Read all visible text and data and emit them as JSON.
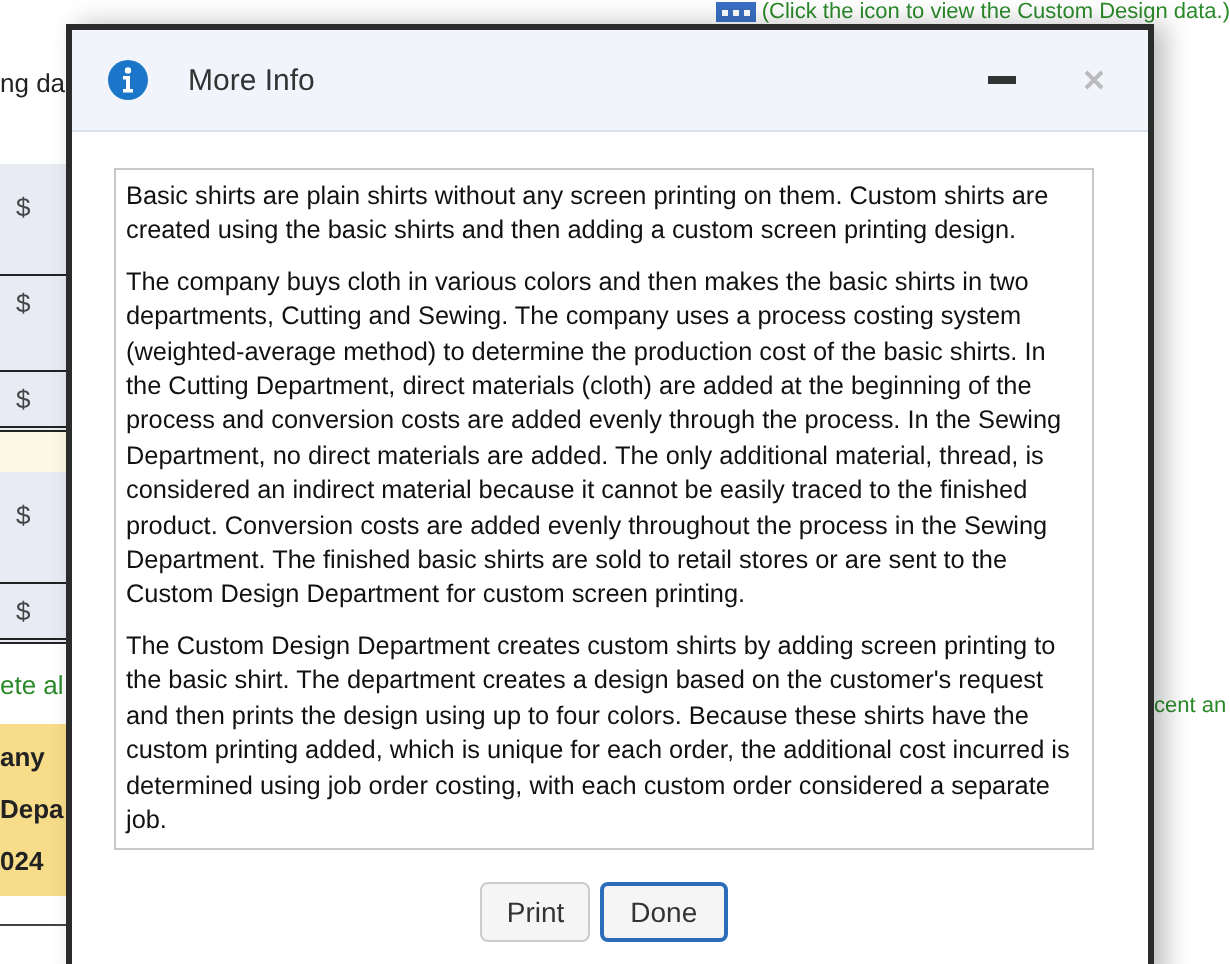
{
  "background": {
    "top_link": "(Click the icon to view the Custom Design data.)",
    "left_column": [
      {
        "kind": "text",
        "text": "ng da"
      },
      {
        "kind": "amounts",
        "rows": [
          {
            "symbol": "$"
          },
          {
            "symbol": "$"
          },
          {
            "symbol": "$"
          }
        ]
      },
      {
        "kind": "gap"
      },
      {
        "kind": "amounts",
        "rows": [
          {
            "symbol": "$"
          },
          {
            "symbol": "$"
          }
        ]
      },
      {
        "kind": "note",
        "text": "ete al"
      },
      {
        "kind": "heading",
        "lines": [
          "any",
          "Depa",
          "024"
        ]
      }
    ],
    "right_note": "cent an"
  },
  "dialog": {
    "title": "More Info",
    "paragraphs": [
      "Basic shirts are plain shirts without any screen printing on them. Custom shirts are created using the basic shirts and then adding a custom screen printing design.",
      "The company buys cloth in various colors and then makes the basic shirts in two departments, Cutting and Sewing. The company uses a process costing system (weighted-average method) to determine the production cost of the basic shirts. In the Cutting Department, direct materials (cloth) are added at the beginning of the process and conversion costs are added evenly through the process. In the Sewing Department, no direct materials are added. The only additional material, thread, is considered an indirect material because it cannot be easily traced to the finished product. Conversion costs are added evenly throughout the process in the Sewing Department. The finished basic shirts are sold to retail stores or are sent to the Custom Design Department for custom screen printing.",
      "The Custom Design Department creates custom shirts by adding screen printing to the basic shirt. The department creates a design based on the customer's request and then prints the design using up to four colors. Because these shirts have the custom printing added, which is unique for each order, the additional cost incurred is determined using job order costing, with each custom order considered a separate job."
    ],
    "buttons": [
      {
        "label": "Print",
        "focused": false
      },
      {
        "label": "Done",
        "focused": true
      }
    ]
  }
}
